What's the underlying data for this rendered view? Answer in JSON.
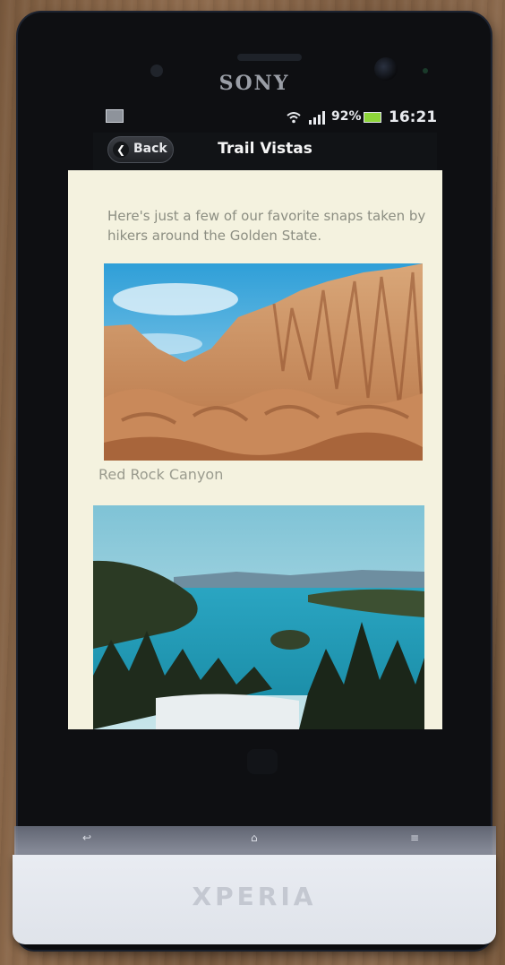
{
  "device": {
    "top_brand": "SONY",
    "bottom_brand": "XPERIA"
  },
  "statusbar": {
    "battery_percent": "92%",
    "time": "16:21",
    "icons": [
      "mail-icon",
      "wifi-icon",
      "signal-icon",
      "battery-icon"
    ]
  },
  "appbar": {
    "back_label": "Back",
    "title": "Trail Vistas"
  },
  "content": {
    "intro": "Here's just a few of our favorite snaps taken by hikers around the Golden State.",
    "photos": [
      {
        "caption": "Red Rock Canyon"
      },
      {
        "caption": ""
      }
    ]
  },
  "colors": {
    "screen_bg": "#f4f2df",
    "appbar_bg": "#111316",
    "battery_fill": "#8ed63a"
  }
}
